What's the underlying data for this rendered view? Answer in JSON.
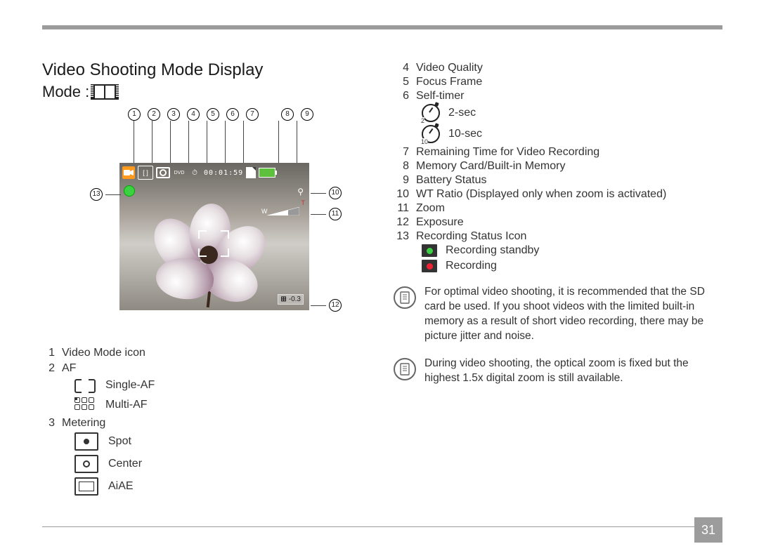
{
  "page": {
    "number": "31"
  },
  "title": "Video Shooting Mode Display",
  "mode_label": "Mode :",
  "diagram": {
    "callout_top": [
      "1",
      "2",
      "3",
      "4",
      "5",
      "6",
      "7",
      "8",
      "9"
    ],
    "callout_side": {
      "ten": "10",
      "eleven": "11",
      "twelve": "12",
      "thirteen": "13"
    },
    "osd": {
      "time": "00:01:59",
      "ev_label": "-0.3",
      "zoom_w": "W",
      "zoom_t": "T",
      "mag": "🔍"
    }
  },
  "left_legend": {
    "i1": {
      "n": "1",
      "t": "Video Mode icon"
    },
    "i2": {
      "n": "2",
      "t": "AF",
      "sub": {
        "a": "Single-AF",
        "b": "Multi-AF"
      }
    },
    "i3": {
      "n": "3",
      "t": "Metering",
      "sub": {
        "a": "Spot",
        "b": "Center",
        "c": "AiAE"
      }
    }
  },
  "right_legend": {
    "i4": {
      "n": "4",
      "t": "Video Quality"
    },
    "i5": {
      "n": "5",
      "t": "Focus Frame"
    },
    "i6": {
      "n": "6",
      "t": "Self-timer",
      "sub": {
        "a": "2-sec",
        "b": "10-sec",
        "na": "2",
        "nb": "10"
      }
    },
    "i7": {
      "n": "7",
      "t": "Remaining Time for Video Recording"
    },
    "i8": {
      "n": "8",
      "t": "Memory Card/Built-in Memory"
    },
    "i9": {
      "n": "9",
      "t": "Battery Status"
    },
    "i10": {
      "n": "10",
      "t": "WT Ratio (Displayed only when zoom is activated)"
    },
    "i11": {
      "n": "11",
      "t": " Zoom"
    },
    "i12": {
      "n": "12",
      "t": "Exposure"
    },
    "i13": {
      "n": "13",
      "t": "Recording Status Icon",
      "sub": {
        "a": "Recording standby",
        "b": "Recording"
      }
    }
  },
  "notes": {
    "a": "For optimal video shooting, it is recommended that the SD card be used. If you shoot videos with the limited built-in memory as a result of short video recording, there may be picture jitter and noise.",
    "b": "During video shooting, the optical zoom is fixed but the highest 1.5x digital zoom is still available."
  }
}
